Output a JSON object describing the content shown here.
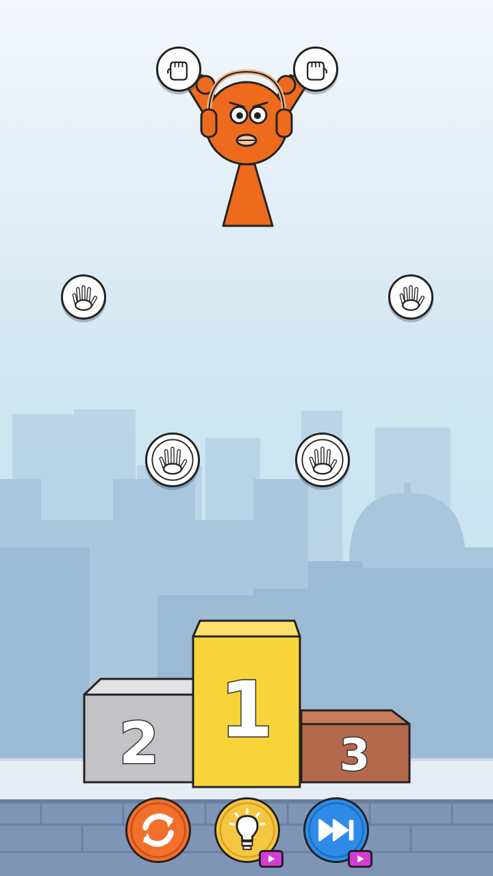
{
  "game": {
    "podium": {
      "first": "1",
      "second": "2",
      "third": "3"
    },
    "controls": [
      {
        "icon": "restart-icon",
        "color": "#f26f2c"
      },
      {
        "icon": "lightbulb-icon",
        "color": "#f5c642",
        "ad": true
      },
      {
        "icon": "fast-forward-icon",
        "color": "#2f8be8",
        "ad": true
      }
    ],
    "colors": {
      "character": "#ee6a1d",
      "podium_first": "#f7d43a",
      "podium_second": "#c3c3c7",
      "podium_third": "#b4684c",
      "ad_badge": "#d63ad6"
    }
  }
}
